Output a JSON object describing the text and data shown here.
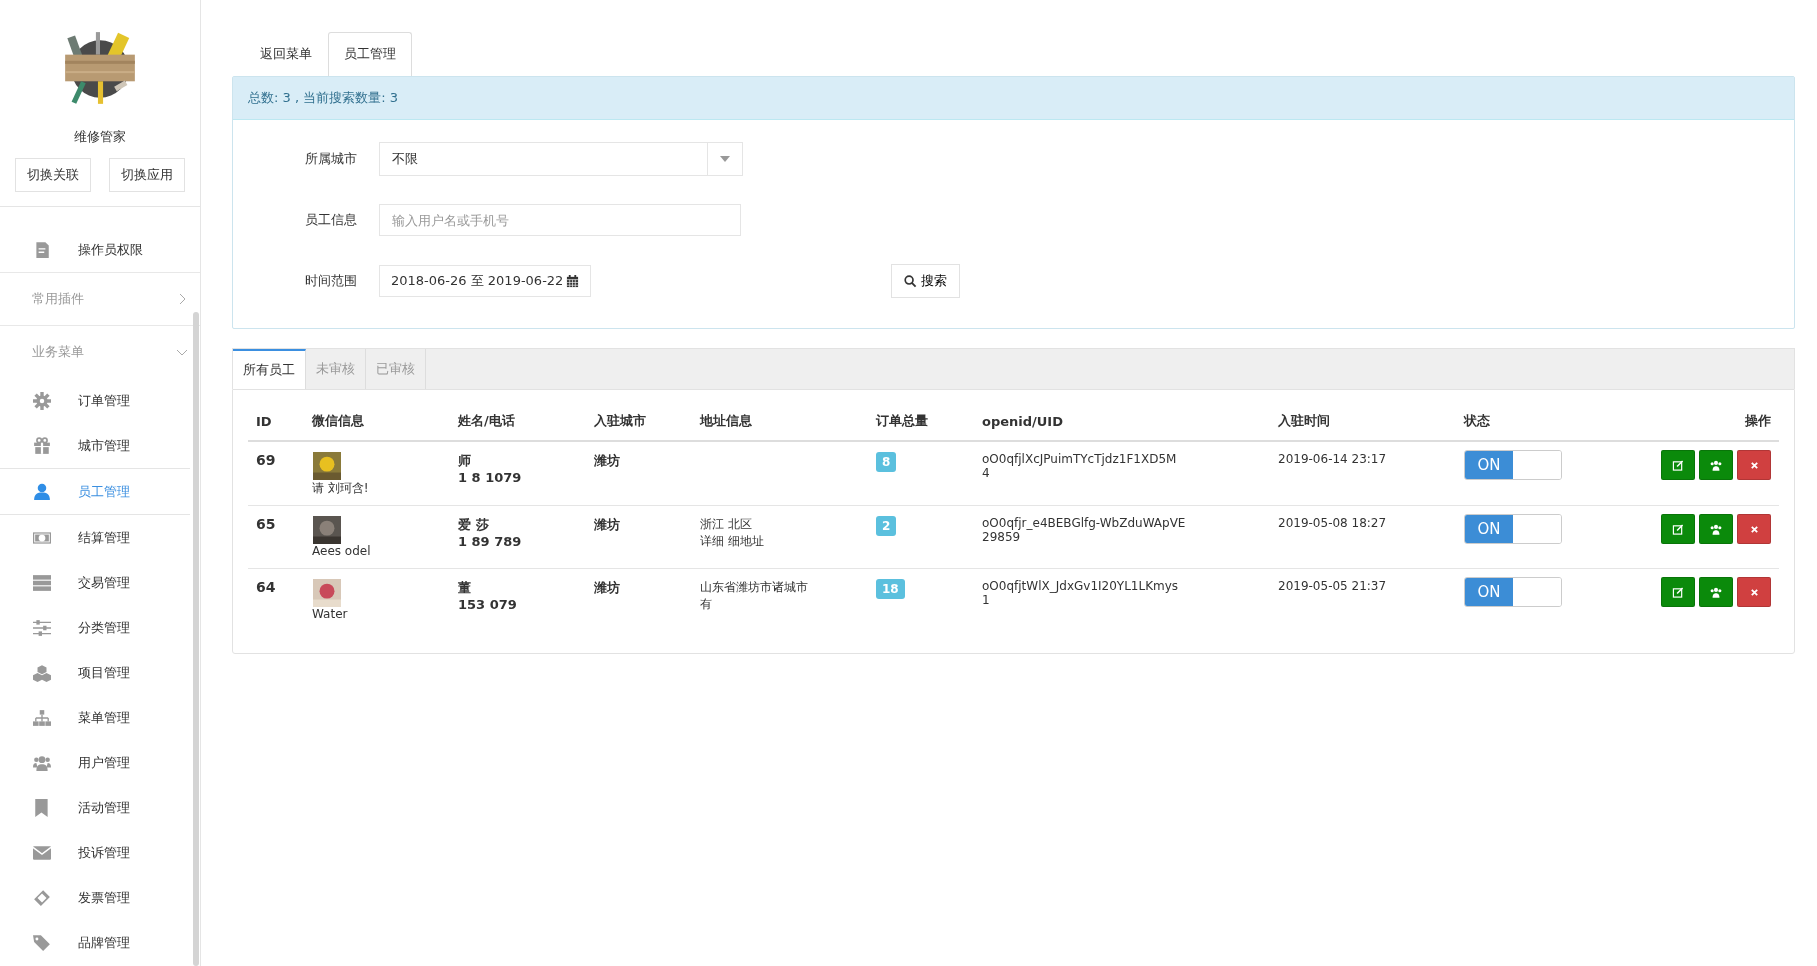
{
  "sidebar": {
    "app_name": "维修管家",
    "buttons": [
      "切换关联",
      "切换应用"
    ],
    "items": [
      {
        "kind": "link",
        "label": "操作员权限",
        "selected": false
      },
      {
        "kind": "section",
        "label": "常用插件",
        "expanded": false
      },
      {
        "kind": "section",
        "label": "业务菜单",
        "expanded": true
      },
      {
        "kind": "link",
        "label": "订单管理",
        "selected": false
      },
      {
        "kind": "link",
        "label": "城市管理",
        "selected": false
      },
      {
        "kind": "link",
        "label": "员工管理",
        "selected": true
      },
      {
        "kind": "link",
        "label": "结算管理",
        "selected": false
      },
      {
        "kind": "link",
        "label": "交易管理",
        "selected": false
      },
      {
        "kind": "link",
        "label": "分类管理",
        "selected": false
      },
      {
        "kind": "link",
        "label": "项目管理",
        "selected": false
      },
      {
        "kind": "link",
        "label": "菜单管理",
        "selected": false
      },
      {
        "kind": "link",
        "label": "用户管理",
        "selected": false
      },
      {
        "kind": "link",
        "label": "活动管理",
        "selected": false
      },
      {
        "kind": "link",
        "label": "投诉管理",
        "selected": false
      },
      {
        "kind": "link",
        "label": "发票管理",
        "selected": false
      },
      {
        "kind": "link",
        "label": "品牌管理",
        "selected": false
      }
    ]
  },
  "top_tabs": [
    {
      "label": "返回菜单",
      "selected": false
    },
    {
      "label": "员工管理",
      "selected": true
    }
  ],
  "summary": "总数: 3 , 当前搜索数量:  3",
  "filters": {
    "city": {
      "label": "所属城市",
      "value": "不限"
    },
    "info": {
      "label": "员工信息",
      "placeholder": "输入用户名或手机号"
    },
    "time": {
      "label": "时间范围",
      "value": "2018-06-26 至 2019-06-22"
    },
    "search_button": "搜索"
  },
  "list_tabs": [
    {
      "label": "所有员工",
      "selected": true
    },
    {
      "label": "未审核",
      "selected": false
    },
    {
      "label": "已审核",
      "selected": false
    }
  ],
  "table": {
    "columns": [
      "ID",
      "微信信息",
      "姓名/电话",
      "入驻城市",
      "地址信息",
      "订单总量",
      "openid/UID",
      "入驻时间",
      "状态",
      "操作"
    ],
    "rows": [
      {
        "id": "69",
        "wechat": "请  刘珂含!",
        "name": "师",
        "phone": "1   8  1079",
        "city": "潍坊",
        "address": [],
        "orders": "8",
        "openid": [
          "oO0qfjlXcJPuimTYcTjdz1F1XD5M",
          "4"
        ],
        "time": "2019-06-14 23:17",
        "status": "ON",
        "on": true
      },
      {
        "id": "65",
        "wechat": "Aees  odel",
        "name": "爱  莎",
        "phone": "1   89  789",
        "city": "潍坊",
        "address": [
          "浙江      北区",
          "详细       细地址"
        ],
        "orders": "2",
        "openid": [
          "oO0qfjr_e4BEBGlfg-WbZduWApVE",
          "29859"
        ],
        "time": "2019-05-08 18:27",
        "status": "ON",
        "on": true
      },
      {
        "id": "64",
        "wechat": "Water",
        "name": "董",
        "phone": "153    079",
        "city": "潍坊",
        "address": [
          "山东省潍坊市诸城市",
          "有"
        ],
        "orders": "18",
        "openid": [
          "oO0qfjtWlX_JdxGv1I20YL1LKmys",
          "1"
        ],
        "time": "2019-05-05 21:37",
        "status": "ON",
        "on": true
      }
    ]
  }
}
